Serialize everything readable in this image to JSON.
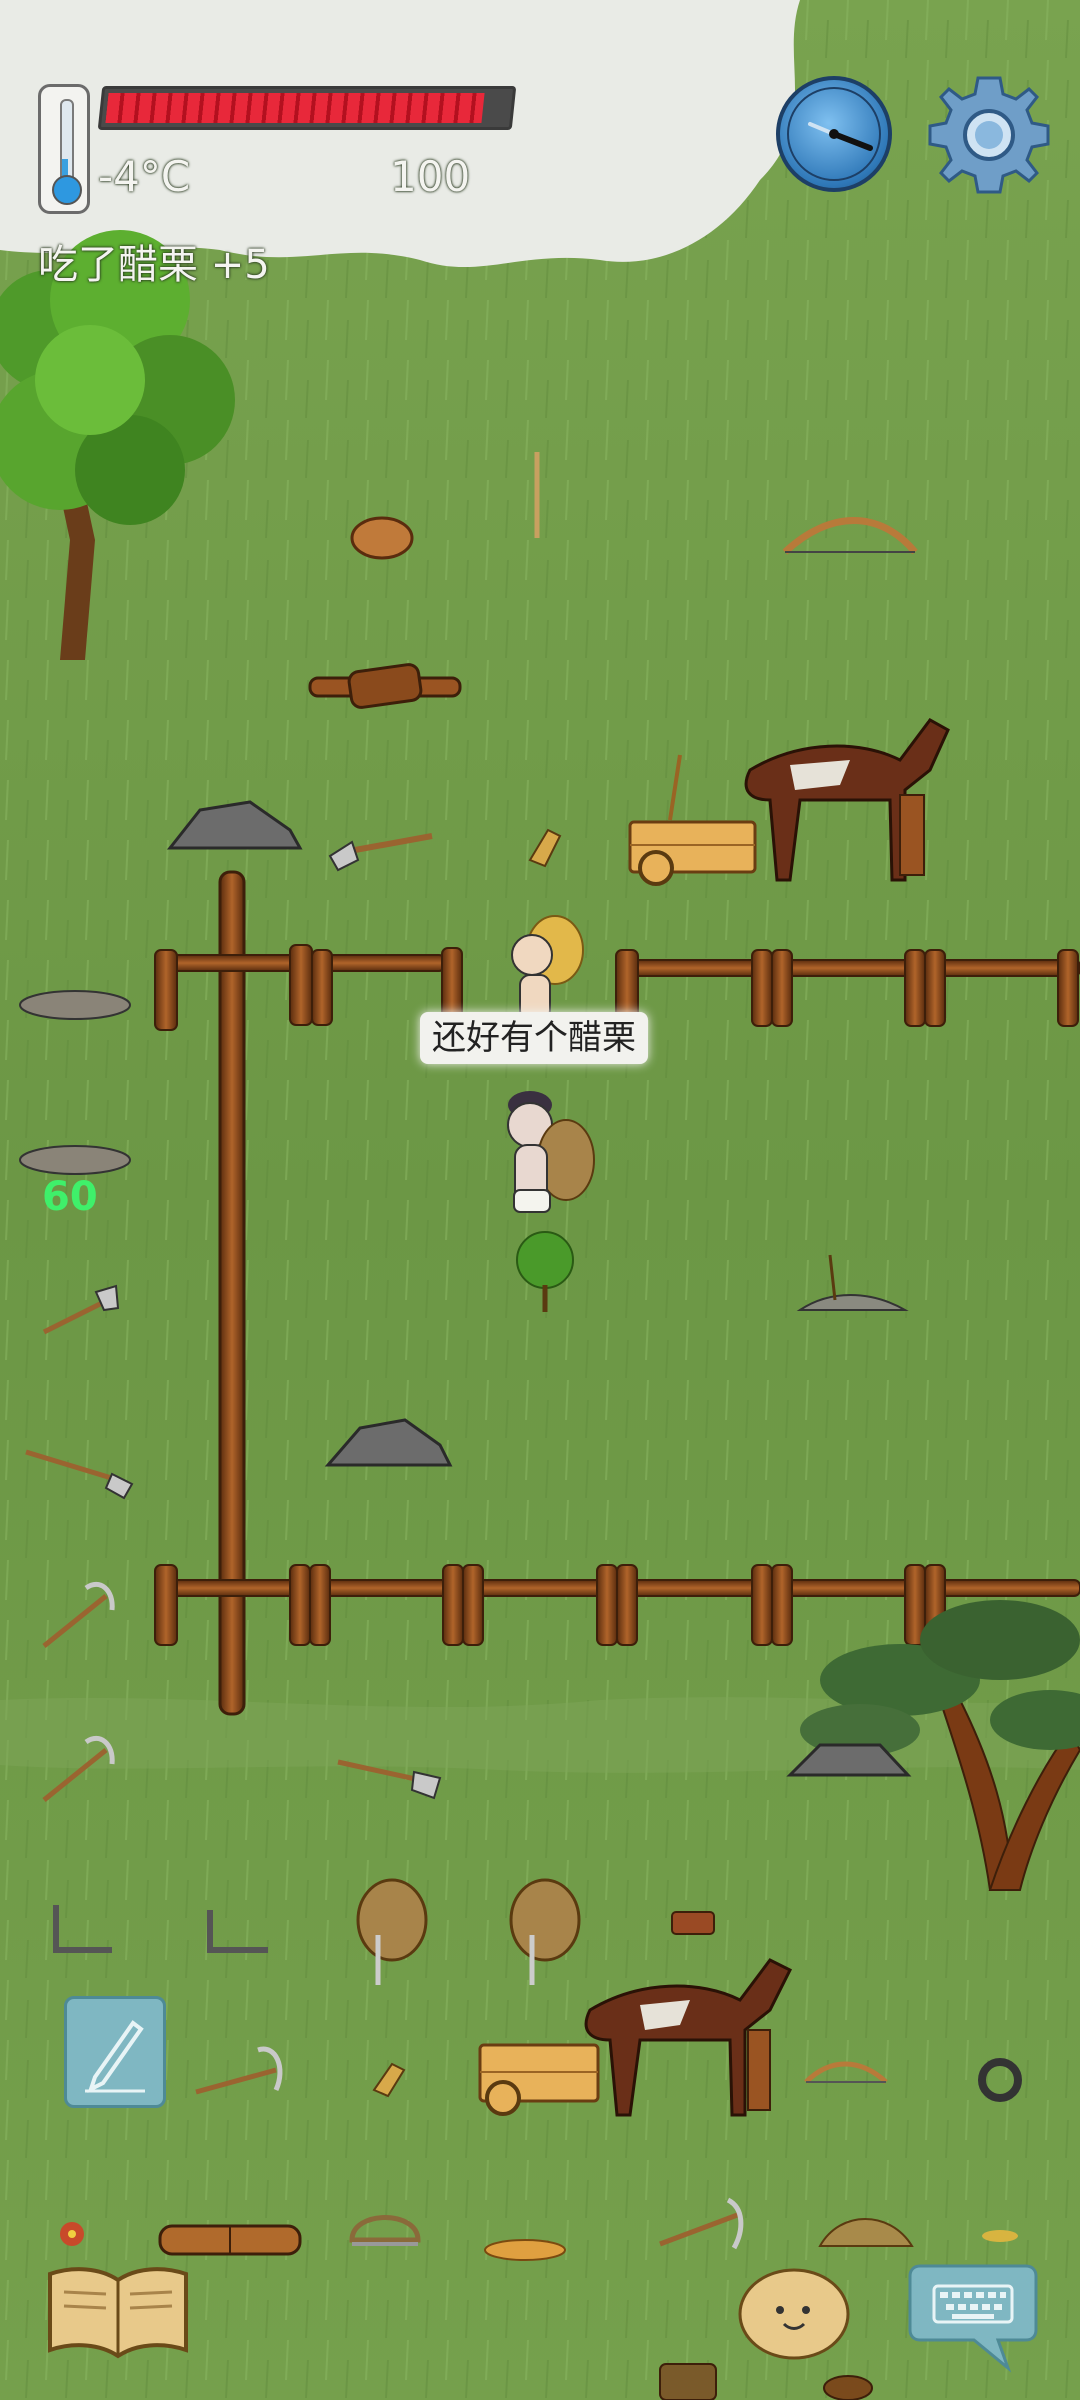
{
  "hud": {
    "temperature": "-4°C",
    "food_value": "100",
    "event_message": "吃了醋栗 +5",
    "health_fraction": 0.94
  },
  "dialogue": {
    "speech_text": "还好有个醋栗"
  },
  "floating_number": "60",
  "icons": {
    "thermometer": "thermometer-icon",
    "compass": "compass-icon",
    "settings": "gear-icon",
    "journal": "pencil-icon",
    "recipe_book": "book-icon",
    "emote": "face-icon",
    "keyboard": "keyboard-icon"
  },
  "colors": {
    "grass": "#6f9a48",
    "health_red": "#e8283a",
    "float_number_green": "#3ff06a",
    "wood": "#8a4a1c"
  }
}
